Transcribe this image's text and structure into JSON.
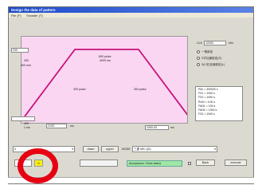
{
  "window": {
    "title": "Design the data of pattern"
  },
  "menu": {
    "items": [
      "File (F)",
      "Transfer (T)"
    ]
  },
  "plot": {
    "top_left_label": "1000 pulse",
    "top_field_value": "2100",
    "top_unit": "pulse",
    "peak_label": "800 pulse",
    "peak_sub": "4000 ms",
    "left_field": "200",
    "left_speed_label": "400",
    "left_speed_unit": "800 mm",
    "mid_left_label": "300 pulse",
    "mid_right_label": "300 pulse",
    "bottom_left_value": "2100",
    "bottom_left_unit": "ms",
    "bottom_right_value": "1000.00",
    "bottom_right_unit": "ms",
    "left_axis_label": "1 ms",
    "left_axis_val": "400"
  },
  "right_panel": {
    "field_label": "CLK",
    "field_value": "10000",
    "field_unit": "kHz",
    "radio_options": [
      "一般設定",
      "S字加速設定(S)",
      "S(L字)加速設定(L)"
    ],
    "info_lines": [
      "PAx = 300000 s",
      "FS1 = 1000 s",
      "FS2 = 1000 s",
      "RUN = 3.00 s",
      "FAN1 = 100 s",
      "FAN2 = 1000 s",
      "FS2 = 1000 s"
    ]
  },
  "bottom": {
    "dropdown_value": "0",
    "btn_down": "down",
    "btn_upper": "upper",
    "mode_label": "MODE",
    "mode_value": "三菱 MR-J(S)",
    "yellow_value": "0",
    "green_text": "Acceptance: 23ms  status",
    "btn_back": "Back",
    "btn_execute": "execute"
  }
}
